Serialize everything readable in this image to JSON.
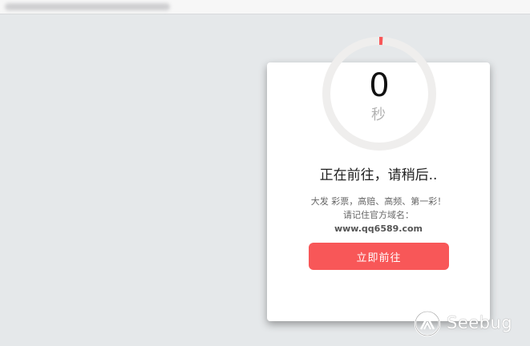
{
  "countdown": {
    "value": "0",
    "unit": "秒",
    "progress_fraction": 0.01
  },
  "message": {
    "heading": "正在前往，请稍后..",
    "line1": "大发 彩票，高赔、高频、第一彩！",
    "line2": "请记住官方域名：",
    "domain": "www.qq6589.com"
  },
  "button": {
    "label": "立即前往"
  },
  "watermark": {
    "text": "Seebug"
  },
  "colors": {
    "background": "#e5e8ea",
    "accent": "#f85758",
    "ring_track": "#efeeed",
    "card": "#ffffff"
  },
  "icons": {
    "watermark": "seebug-logo-icon"
  }
}
